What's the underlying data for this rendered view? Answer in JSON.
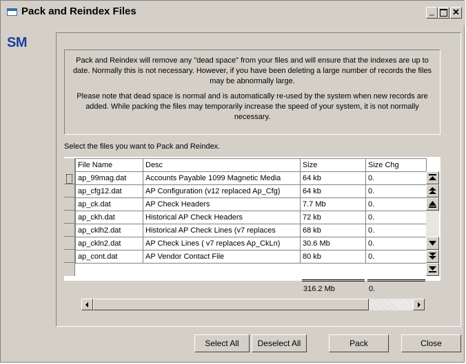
{
  "window": {
    "title": "Pack and Reindex Files",
    "logo_text": "SM"
  },
  "info": {
    "paragraph1": "Pack and Reindex will remove any \"dead space\" from your files and will ensure that the indexes are up to date.  Normally this is not necessary.  However, if you have been deleting a large number of records the files may be abnormally large.",
    "paragraph2": "Please note that dead space is normal and is automatically re-used by the system when new records are added.  While packing the files may temporarily increase the speed of your system, it is not normally necessary."
  },
  "select_label": "Select the files you want to Pack and Reindex.",
  "grid": {
    "columns": [
      "File Name",
      "Desc",
      "Size",
      "Size Chg"
    ],
    "rows": [
      [
        "ap_99mag.dat",
        "Accounts Payable 1099 Magnetic Media",
        "64 kb",
        "0."
      ],
      [
        "ap_cfg12.dat",
        "AP Configuration (v12 replaced Ap_Cfg)",
        "64 kb",
        "0."
      ],
      [
        "ap_ck.dat",
        "AP Check Headers",
        "7.7 Mb",
        "0."
      ],
      [
        "ap_ckh.dat",
        "Historical AP Check Headers",
        "72 kb",
        "0."
      ],
      [
        "ap_cklh2.dat",
        "Historical AP Check Lines (v7 replaces",
        "68 kb",
        "0."
      ],
      [
        "ap_ckln2.dat",
        "AP Check Lines ( v7 replaces Ap_CkLn)",
        "30.6 Mb",
        "0."
      ],
      [
        "ap_cont.dat",
        "AP Vendor Contact File",
        "80 kb",
        "0."
      ]
    ],
    "total_size": "316.2 Mb",
    "total_size_chg": "0."
  },
  "buttons": {
    "select_all": "Select All",
    "deselect_all": "Deselect All",
    "pack": "Pack",
    "close": "Close"
  },
  "colors": {
    "face": "#d4d0c8",
    "logo": "#1f3f9f",
    "title_icon": "#3a6ea5"
  }
}
